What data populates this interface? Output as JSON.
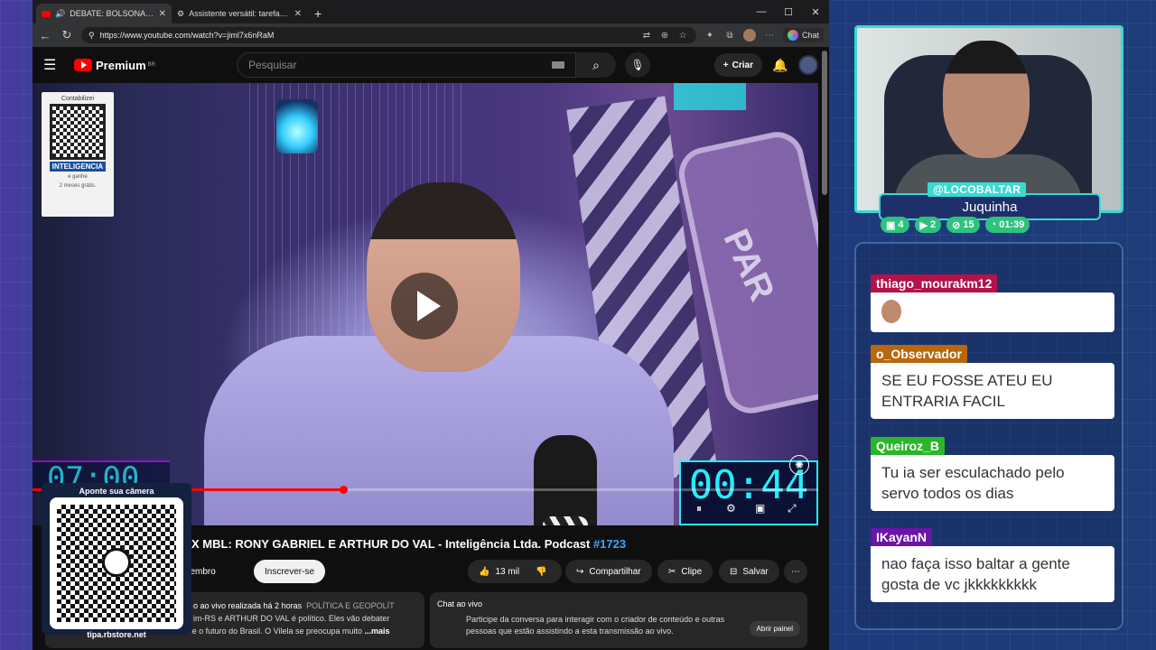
{
  "browser": {
    "tabs": [
      {
        "label": "DEBATE: BOLSONARISTA X M",
        "active": true
      },
      {
        "label": "Assistente versátil: tarefas, respost",
        "active": false
      }
    ],
    "url": "https://www.youtube.com/watch?v=jiml7x6nRaM",
    "chat_label": "Chat"
  },
  "youtube": {
    "logo": "Premium",
    "logo_region": "BR",
    "search_placeholder": "Pesquisar",
    "create_label": "Criar",
    "video_title_prefix": "X MBL: RONY GABRIEL E ARTHUR DO VAL - Inteligência Ltda. Podcast ",
    "video_title_hash": "#1723",
    "join_label": "eja membro",
    "subscribe_label": "Inscrever-se",
    "likes": "13 mil",
    "share_label": "Compartilhar",
    "clip_label": "Clipe",
    "save_label": "Salvar",
    "desc_meta": "o ao vivo realizada há 2 horas",
    "desc_tag": "POLÍTICA E GEOPOLÍT",
    "desc_line2": "im-RS e ARTHUR DO VAL é político. Eles vão debater",
    "desc_line3": "sobre Bolsonaro, a política da direita e o futuro do Brasil. O Vilela se preocupa muito",
    "desc_more": "...mais",
    "livechat_title": "Chat ao vivo",
    "livechat_text": "Participe da conversa para interagir com o criador de conteúdo e outras pessoas que estão assistindo a esta transmissão ao vivo.",
    "livechat_button": "Abrir painel"
  },
  "video": {
    "qr_top_label": "Contabilizei",
    "qr_top_brand": "INTELIGENCIA",
    "qr_top_line1": "e ganhe",
    "qr_top_line2": "2 meses grátis.",
    "timer_left": "07:00",
    "timer_right": "00:44",
    "sign_text": "PAR",
    "progress": 0.395
  },
  "qr_overlay": {
    "top": "Aponte sua câmera",
    "bottom": "tipa.rbstore.net"
  },
  "stream": {
    "handle": "@LOCOBALTAR",
    "name": "Juquinha",
    "stats": [
      {
        "icon": "chat-icon",
        "value": "4",
        "color": "#2ec27e"
      },
      {
        "icon": "video-icon",
        "value": "2",
        "color": "#2ec27e"
      },
      {
        "icon": "link-icon",
        "value": "15",
        "color": "#2ec27e"
      },
      {
        "icon": "clock-icon",
        "value": "01:39",
        "color": "#2ec27e"
      }
    ]
  },
  "chat": [
    {
      "user": "thiago_mourakm12",
      "color": "#b3124a",
      "text": ""
    },
    {
      "user": "o_Observador",
      "color": "#b8670e",
      "text": "SE EU FOSSE ATEU EU ENTRARIA FACIL"
    },
    {
      "user": "Queiroz_B",
      "color": "#2bb52b",
      "text": "Tu ia ser esculachado pelo servo todos os dias"
    },
    {
      "user": "IKayanN",
      "color": "#6a14a8",
      "text": "nao faça isso baltar a gente gosta de vc jkkkkkkkkk"
    }
  ]
}
